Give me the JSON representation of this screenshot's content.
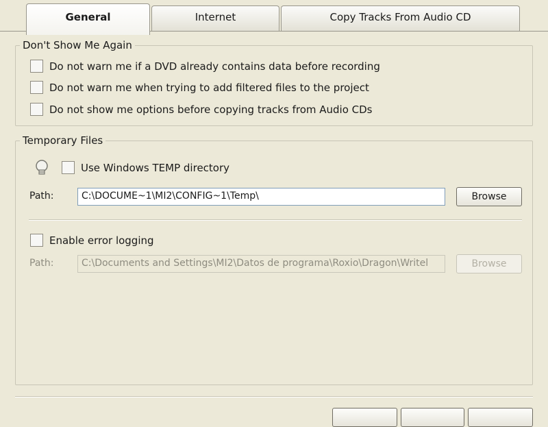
{
  "tabs": [
    {
      "label": "General",
      "active": true
    },
    {
      "label": "Internet",
      "active": false
    },
    {
      "label": "Copy Tracks From Audio CD",
      "active": false
    }
  ],
  "dont_show": {
    "legend": "Don't Show Me Again",
    "items": [
      {
        "label": "Do not warn me if a DVD already contains data before recording",
        "checked": false
      },
      {
        "label": "Do not warn me when trying to add filtered files to the project",
        "checked": false
      },
      {
        "label": "Do not show me options before copying tracks from Audio CDs",
        "checked": false
      }
    ]
  },
  "temp_files": {
    "legend": "Temporary Files",
    "hint_icon": "lightbulb-icon",
    "use_windows_temp": {
      "label": "Use Windows TEMP directory",
      "checked": false
    },
    "path_label": "Path:",
    "path_value": "C:\\DOCUME~1\\MI2\\CONFIG~1\\Temp\\",
    "browse_label": "Browse",
    "error_logging": {
      "label": "Enable error logging",
      "checked": false
    },
    "log_path_label": "Path:",
    "log_path_value": "C:\\Documents and Settings\\MI2\\Datos de programa\\Roxio\\Dragon\\Writel",
    "log_browse_label": "Browse"
  }
}
